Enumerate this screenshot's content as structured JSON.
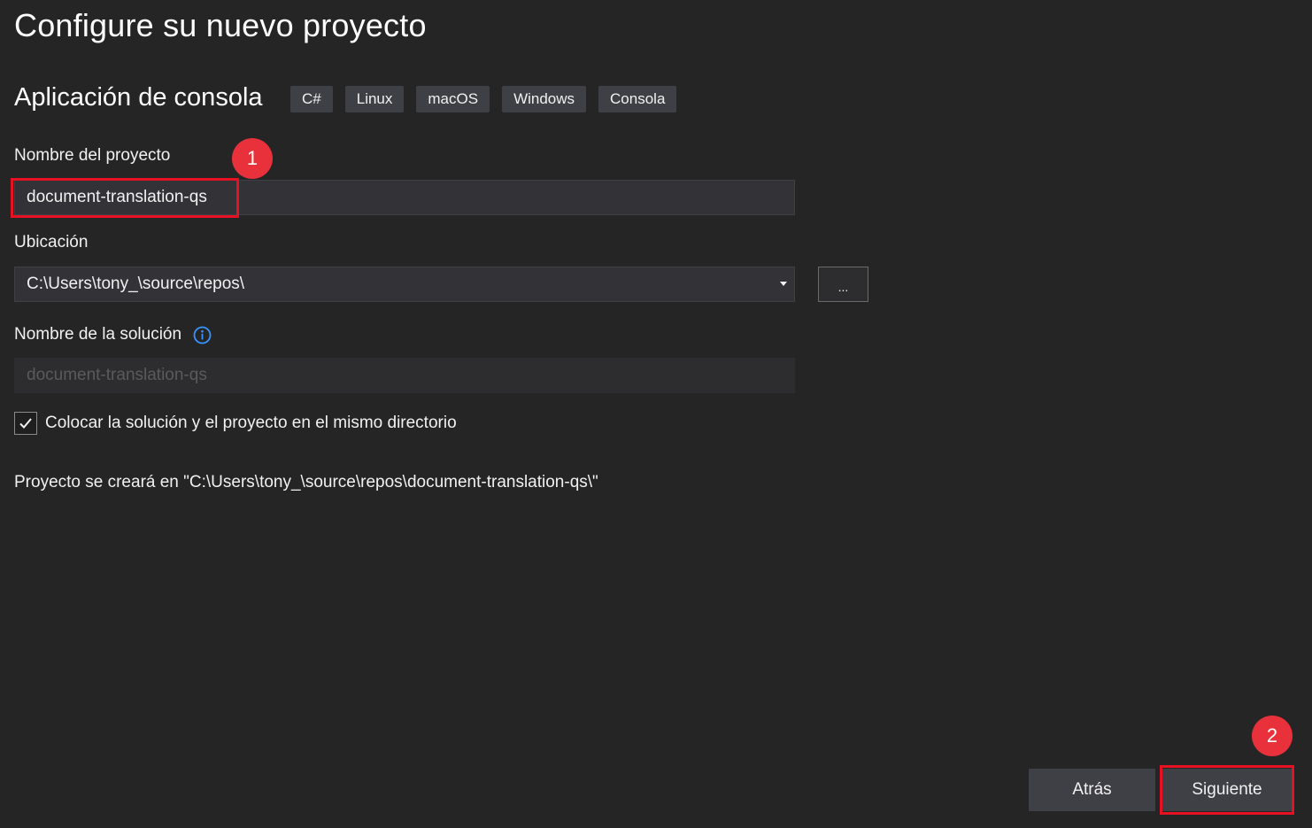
{
  "page": {
    "title": "Configure su nuevo proyecto"
  },
  "template": {
    "name": "Aplicación de consola",
    "tags": [
      "C#",
      "Linux",
      "macOS",
      "Windows",
      "Consola"
    ]
  },
  "project_name": {
    "label": "Nombre del proyecto",
    "value": "document-translation-qs"
  },
  "location": {
    "label": "Ubicación",
    "value": "C:\\Users\\tony_\\source\\repos\\",
    "browse_label": "..."
  },
  "solution_name": {
    "label": "Nombre de la solución",
    "placeholder": "document-translation-qs",
    "icon": "info-icon"
  },
  "same_directory": {
    "label": "Colocar la solución y el proyecto en el mismo directorio",
    "checked": true
  },
  "summary": {
    "text": "Proyecto se creará en \"C:\\Users\\tony_\\source\\repos\\document-translation-qs\\\""
  },
  "footer": {
    "back_label": "Atrás",
    "next_label": "Siguiente"
  },
  "callouts": {
    "first": "1",
    "second": "2"
  },
  "colors": {
    "background": "#252526",
    "accent_info": "#3794ff",
    "highlight": "#e81123",
    "callout": "#e8313a"
  }
}
